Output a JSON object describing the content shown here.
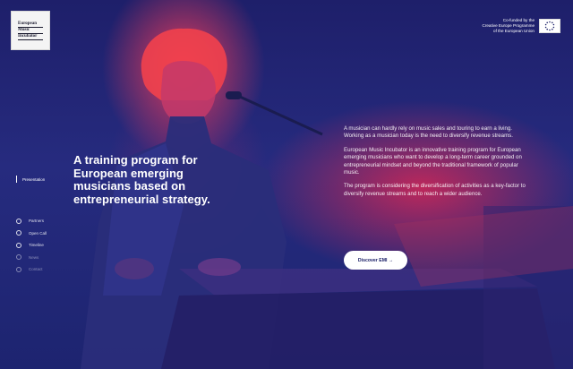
{
  "logo": {
    "lines": [
      "European",
      "Music",
      "Incubator"
    ]
  },
  "cofunded": {
    "lines": [
      "Co-funded by the",
      "Creative Europe Programme",
      "of the European Union"
    ]
  },
  "sidebar": {
    "section_label": "Presentation",
    "items": [
      {
        "label": "Partners",
        "active": false
      },
      {
        "label": "Open Call",
        "active": false
      },
      {
        "label": "Timeline",
        "active": false
      },
      {
        "label": "News",
        "active": false
      },
      {
        "label": "Contact",
        "active": false
      }
    ]
  },
  "hero": {
    "headline": "A training program for European emerging musicians based on entrepreneurial strategy.",
    "paragraphs": [
      "A musician can hardly rely on music sales and touring to earn a living. Working as a musician today is the need to diversify revenue streams.",
      "European Music Incubator is an innovative training program for European emerging musicians who want to develop a long-term career grounded on entrepreneurial mindset and beyond the traditional framework of popular music.",
      "The program is considering the diversification of activities as a key-factor to diversify revenue streams and to reach a wider audience."
    ],
    "cta_label": "Discover EMI →"
  },
  "colors": {
    "background": "#1c2068",
    "accent": "#e8345a"
  }
}
